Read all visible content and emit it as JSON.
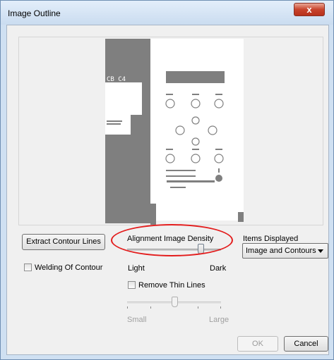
{
  "window": {
    "title": "Image Outline",
    "close_glyph": "x"
  },
  "buttons": {
    "extract": "Extract Contour Lines",
    "ok": "OK",
    "cancel": "Cancel"
  },
  "density": {
    "label": "Alignment Image Density",
    "min_label": "Light",
    "max_label": "Dark",
    "level": 0.78
  },
  "items_displayed": {
    "label": "Items Displayed",
    "selected": "Image and Contours"
  },
  "welding": {
    "label": "Welding Of Contour",
    "checked": false
  },
  "thin_lines": {
    "label": "Remove Thin Lines",
    "checked": false,
    "min_label": "Small",
    "max_label": "Large",
    "level": 0.5
  },
  "preview": {
    "text": "CB C4"
  },
  "annotation": {
    "color": "#e31c1c"
  }
}
